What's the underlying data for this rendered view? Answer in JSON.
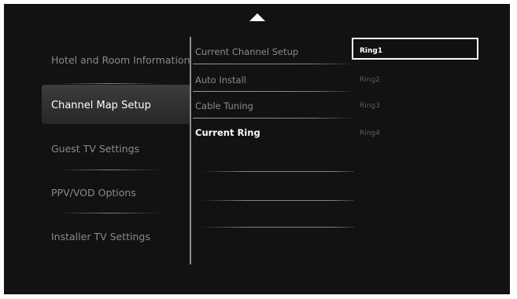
{
  "left_menu": {
    "items": [
      {
        "label": "Hotel and Room Information"
      },
      {
        "label": "Channel Map Setup"
      },
      {
        "label": "Guest TV Settings"
      },
      {
        "label": "PPV/VOD Options"
      },
      {
        "label": "Installer TV Settings"
      }
    ],
    "selected": "Channel Map Setup"
  },
  "middle_menu": {
    "items": [
      {
        "label": "Current Channel Setup"
      },
      {
        "label": "Auto Install"
      },
      {
        "label": "Cable Tuning"
      },
      {
        "label": "Current Ring"
      }
    ]
  },
  "ring_list": {
    "items": [
      {
        "label": "Ring1"
      },
      {
        "label": "Ring2"
      },
      {
        "label": "Ring3"
      },
      {
        "label": "Ring4"
      }
    ],
    "selected": "Ring1"
  },
  "icons": {
    "up_arrow": "triangle-up-icon"
  },
  "colors": {
    "background": "#121212",
    "text_dim": "#8a8a8a",
    "text_bright": "#ffffff",
    "ring_dim": "#5c5c5c",
    "selection_box": "#ffffff"
  }
}
